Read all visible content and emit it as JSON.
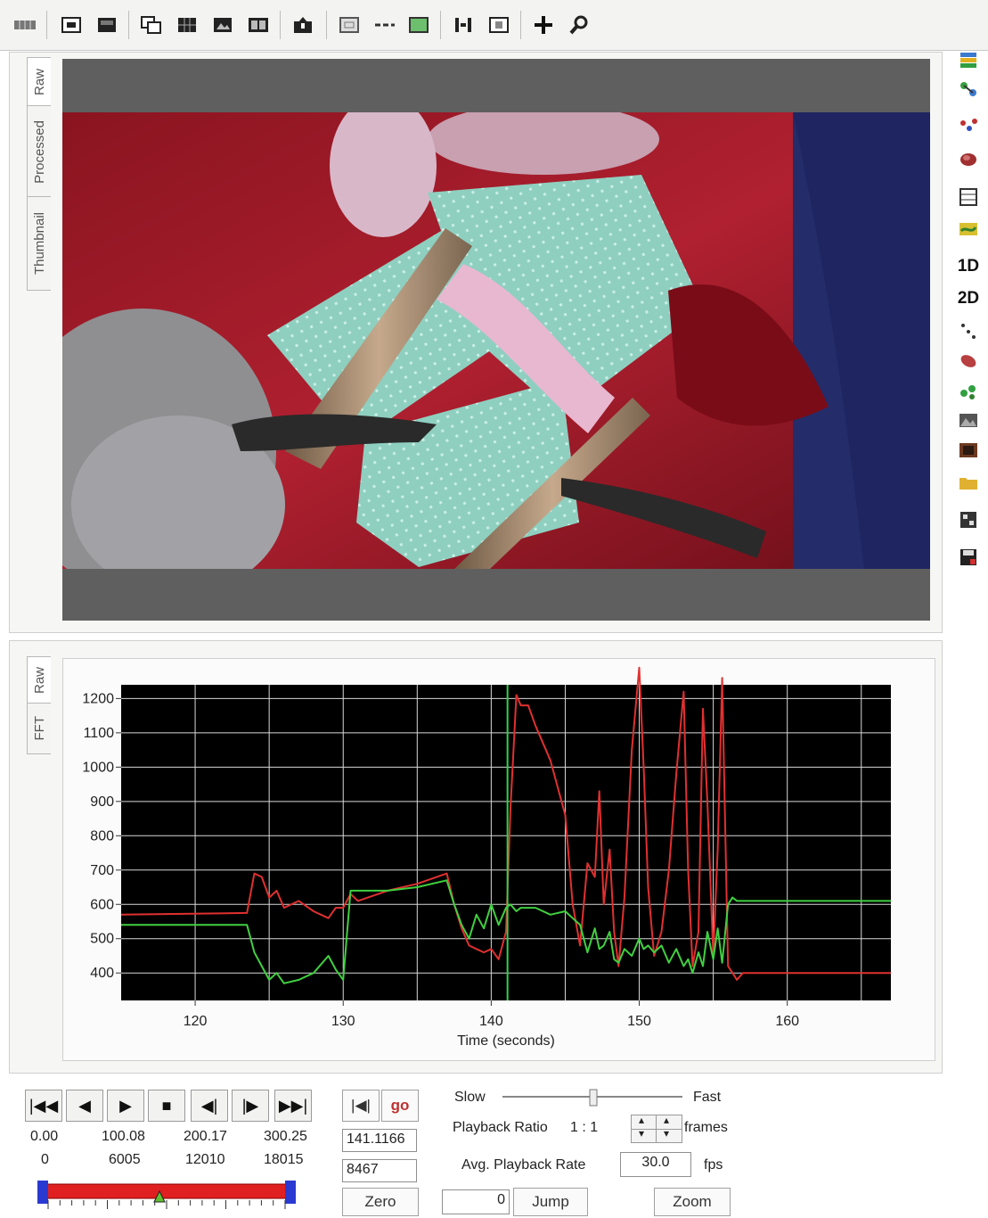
{
  "colors": {
    "red_series": "#e03030",
    "green_series": "#40d040",
    "cursor": "#2fd24a",
    "plot_bg": "#000000"
  },
  "toolbar": {
    "icons": [
      "grid-menu-icon",
      "window-icon",
      "screen-icon",
      "tile-windows-icon",
      "grid-4-icon",
      "image-frame-icon",
      "dual-frame-icon",
      "import-icon",
      "rect-select-icon",
      "line-tool-icon",
      "green-rect-icon",
      "split-icon",
      "crop-icon",
      "crosshair-icon",
      "zoom-wand-icon"
    ]
  },
  "video_tabs": [
    "Raw",
    "Processed",
    "Thumbnail"
  ],
  "chart_tabs": [
    "Raw",
    "FFT"
  ],
  "right_toolbar": {
    "labels": [
      "1D",
      "2D"
    ]
  },
  "chart_data": {
    "type": "line",
    "xlabel": "Time (seconds)",
    "ylabel": "",
    "xlim": [
      115,
      167
    ],
    "ylim": [
      320,
      1240
    ],
    "xticks": [
      120,
      130,
      140,
      150,
      160
    ],
    "yticks": [
      400,
      500,
      600,
      700,
      800,
      900,
      1000,
      1100,
      1200
    ],
    "cursor_x": 141.1,
    "grid": true,
    "series": [
      {
        "color": "#e03030",
        "x": [
          115,
          123.5,
          124,
          124.5,
          125,
          125.5,
          126,
          127,
          128,
          129,
          129.5,
          130,
          130.5,
          131,
          133,
          135,
          137,
          137.5,
          138,
          138.5,
          139,
          139.5,
          140,
          140.5,
          141,
          141.3,
          141.7,
          142,
          142.5,
          143,
          144,
          145,
          145.5,
          146,
          146.5,
          147,
          147.3,
          147.6,
          148,
          148.3,
          148.6,
          149,
          149.5,
          150,
          150.3,
          150.6,
          151,
          151.5,
          152,
          152.5,
          153,
          153.3,
          153.6,
          154,
          154.3,
          154.6,
          155,
          155.3,
          155.6,
          156,
          156.3,
          156.6,
          157,
          167
        ],
        "y": [
          570,
          575,
          690,
          680,
          620,
          640,
          590,
          610,
          580,
          560,
          590,
          590,
          630,
          610,
          640,
          660,
          690,
          600,
          530,
          480,
          470,
          460,
          470,
          440,
          520,
          880,
          1210,
          1180,
          1180,
          1120,
          1020,
          860,
          600,
          480,
          720,
          680,
          930,
          600,
          760,
          520,
          420,
          620,
          1050,
          1290,
          1000,
          650,
          450,
          520,
          700,
          980,
          1220,
          700,
          420,
          520,
          1170,
          900,
          450,
          760,
          1260,
          420,
          400,
          380,
          400,
          400
        ]
      },
      {
        "color": "#40d040",
        "x": [
          115,
          123.5,
          124,
          124.5,
          125,
          125.5,
          126,
          127,
          128,
          129,
          129.5,
          130,
          130.5,
          131,
          133,
          135,
          137,
          137.5,
          138,
          138.5,
          139,
          139.5,
          140,
          140.5,
          141,
          141.3,
          141.7,
          142,
          142.5,
          143,
          144,
          145,
          145.5,
          146,
          146.5,
          147,
          147.3,
          147.6,
          148,
          148.3,
          148.6,
          149,
          149.5,
          150,
          150.3,
          150.6,
          151,
          151.5,
          152,
          152.5,
          153,
          153.3,
          153.6,
          154,
          154.3,
          154.6,
          155,
          155.3,
          155.6,
          156,
          156.3,
          156.6,
          157,
          167
        ],
        "y": [
          540,
          540,
          460,
          420,
          380,
          400,
          370,
          380,
          400,
          450,
          410,
          380,
          640,
          640,
          640,
          650,
          670,
          600,
          540,
          500,
          570,
          530,
          600,
          540,
          590,
          600,
          580,
          590,
          590,
          590,
          570,
          580,
          560,
          540,
          460,
          530,
          470,
          480,
          520,
          440,
          430,
          470,
          450,
          500,
          470,
          480,
          460,
          480,
          430,
          470,
          420,
          440,
          400,
          460,
          420,
          520,
          440,
          530,
          430,
          600,
          620,
          610,
          610,
          610
        ]
      }
    ]
  },
  "playback": {
    "buttons": [
      "|◀◀",
      "◀",
      "▶",
      "■",
      "◀|",
      "|▶",
      "▶▶|"
    ],
    "times": [
      "0.00",
      "100.08",
      "200.17",
      "300.25"
    ],
    "frames": [
      "0",
      "6005",
      "12010",
      "18015"
    ],
    "slider_value": 0.47,
    "side_icons": [
      "|◀|",
      "go"
    ],
    "time_value": "141.1166",
    "frame_value": "8467",
    "zero_label": "Zero",
    "jump_value": "0",
    "jump_label": "Jump",
    "slow_label": "Slow",
    "fast_label": "Fast",
    "speed_value": 0.5,
    "ratio_label": "Playback Ratio",
    "ratio_value": "1 : 1",
    "frames_label": "frames",
    "rate_label": "Avg. Playback Rate",
    "rate_value": "30.0",
    "fps_label": "fps",
    "zoom_label": "Zoom"
  }
}
